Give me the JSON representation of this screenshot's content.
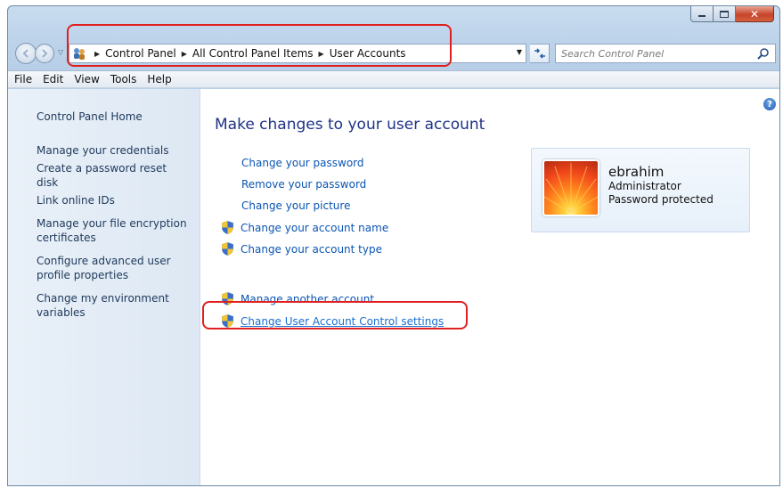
{
  "window": {
    "caption": {
      "minimize": "–",
      "maximize": "□",
      "close": "✕"
    }
  },
  "navbar": {
    "back_icon": "arrow-left-icon",
    "forward_icon": "arrow-right-icon",
    "breadcrumb": [
      "Control Panel",
      "All Control Panel Items",
      "User Accounts"
    ],
    "search_placeholder": "Search Control Panel"
  },
  "menu": [
    "File",
    "Edit",
    "View",
    "Tools",
    "Help"
  ],
  "left_pane": {
    "home": "Control Panel Home",
    "links": [
      "Manage your credentials",
      "Create a password reset disk",
      "Link online IDs",
      "Manage your file encryption certificates",
      "Configure advanced user profile properties",
      "Change my environment variables"
    ]
  },
  "main": {
    "title": "Make changes to your user account",
    "tasks": [
      "Change your password",
      "Remove your password",
      "Change your picture",
      "Change your account name",
      "Change your account type"
    ],
    "other_tasks": [
      "Manage another account",
      "Change User Account Control settings"
    ]
  },
  "user": {
    "name": "ebrahim",
    "role": "Administrator",
    "status": "Password protected"
  },
  "colors": {
    "link": "#0b55b3",
    "title": "#1e3287",
    "highlight": "#e02020"
  }
}
